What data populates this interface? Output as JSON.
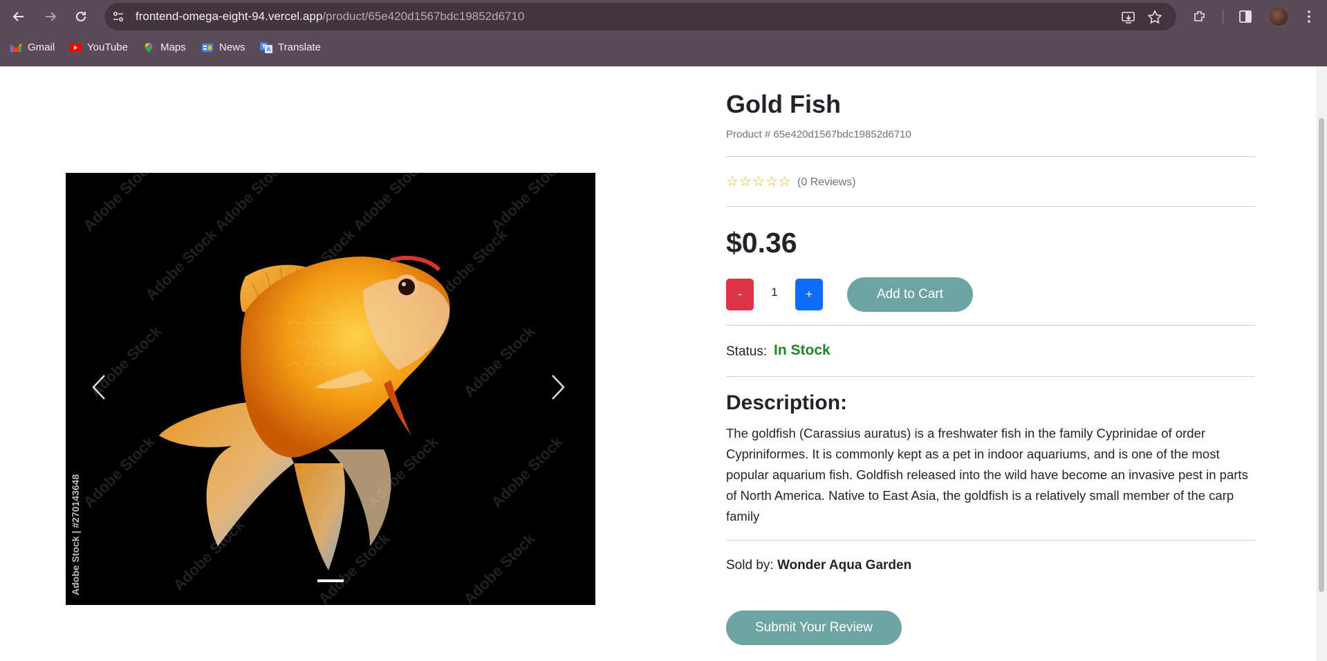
{
  "browser": {
    "url_host": "frontend-omega-eight-94.vercel.app",
    "url_path": "/product/65e420d1567bdc19852d6710",
    "bookmarks": [
      {
        "label": "Gmail",
        "icon": "gmail-icon"
      },
      {
        "label": "YouTube",
        "icon": "youtube-icon"
      },
      {
        "label": "Maps",
        "icon": "maps-icon"
      },
      {
        "label": "News",
        "icon": "news-icon"
      },
      {
        "label": "Translate",
        "icon": "translate-icon"
      }
    ]
  },
  "carousel": {
    "watermark": "Adobe Stock",
    "stock_tag": "Adobe Stock | #270143648",
    "prev_icon": "chevron-left-icon",
    "next_icon": "chevron-right-icon"
  },
  "product": {
    "name": "Gold Fish",
    "id_text": "Product # 65e420d1567bdc19852d6710",
    "rating": 0,
    "reviews_text": "(0 Reviews)",
    "price": "$0.36",
    "qty_minus": "-",
    "qty_plus": "+",
    "quantity": "1",
    "add_to_cart": "Add to Cart",
    "status_label": "Status:",
    "status_value": "In Stock",
    "description_heading": "Description:",
    "description": "The goldfish (Carassius auratus) is a freshwater fish in the family Cyprinidae of order Cypriniformes. It is commonly kept as a pet in indoor aquariums, and is one of the most popular aquarium fish. Goldfish released into the wild have become an invasive pest in parts of North America. Native to East Asia, the goldfish is a relatively small member of the carp family",
    "sold_by_label": "Sold by:",
    "seller": "Wonder Aqua Garden",
    "submit_review": "Submit Your Review"
  },
  "colors": {
    "chrome": "#5b4a57",
    "accent_button": "#6ea5a2",
    "minus": "#dc3545",
    "plus": "#0d6efd",
    "in_stock": "#198a1f",
    "star": "#e8b60a"
  }
}
